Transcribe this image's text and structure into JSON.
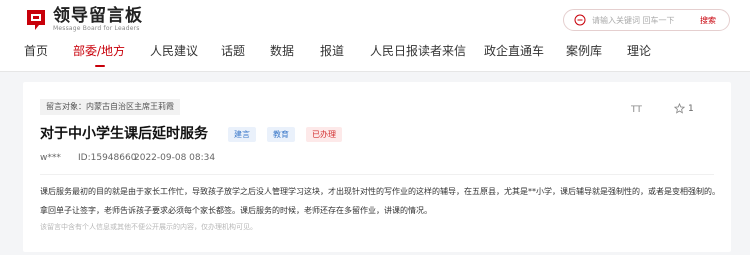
{
  "header": {
    "logo_cn": "领导留言板",
    "logo_en": "Message Board for Leaders",
    "search_placeholder": "请输入关键词 回车一下",
    "search_button": "搜索"
  },
  "nav": {
    "items": [
      "首页",
      "部委/地方",
      "人民建议",
      "话题",
      "数据",
      "报道",
      "人民日报读者来信",
      "政企直通车",
      "案例库",
      "理论"
    ],
    "active_index": 1
  },
  "message": {
    "target": "留言对象：内蒙古自治区主席王莉霞",
    "title": "对于中小学生课后延时服务",
    "tags": [
      "建言",
      "教育"
    ],
    "status": "已办理",
    "user": "w***",
    "id": "ID:15948660",
    "datetime": "2022-09-08 08:34",
    "fontsize_label": "TT",
    "star_count": "1",
    "content": "课后服务最初的目的就是由于家长工作忙，导致孩子放学之后没人管理学习这块，才出现针对性的写作业的这样的辅导，在五原县，尤其是**小学，课后辅导就是强制性的，或者是变相强制的。拿回单子让签字，老师告诉孩子要求必须每个家长都签。课后服务的时候，老师还存在多留作业，讲课的情况。",
    "disclaimer": "该留言中含有个人信息或其他不便公开展示的内容，仅办理机构可见。"
  },
  "colors": {
    "brand_red": "#c8000a",
    "tag_blue": "#3a78c9",
    "status_red": "#d33131"
  }
}
